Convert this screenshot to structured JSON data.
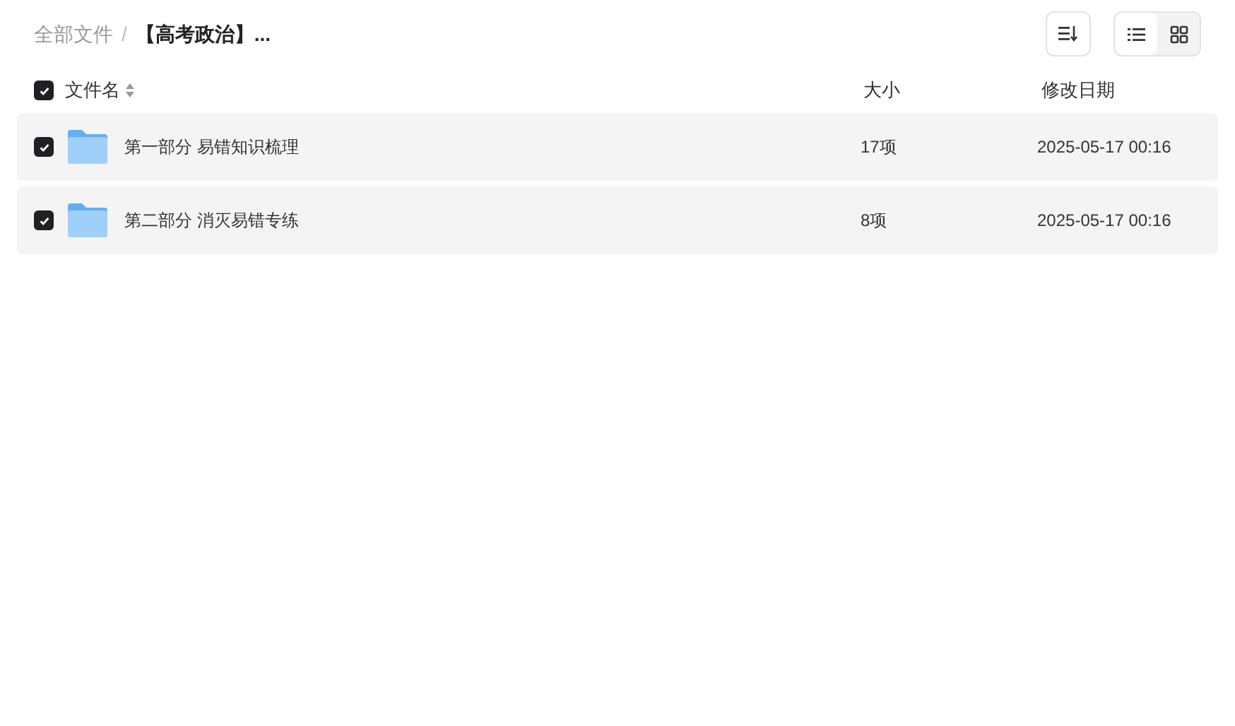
{
  "breadcrumb": [
    {
      "label": "全部文件",
      "current": false
    },
    {
      "label": "【高考政治】...",
      "current": true
    }
  ],
  "breadcrumb_separator": "/",
  "view_modes": [
    {
      "kind": "list",
      "selected": true
    },
    {
      "kind": "grid",
      "selected": false
    }
  ],
  "header": {
    "checked": true,
    "columns": [
      "文件名",
      "大小",
      "修改日期"
    ]
  },
  "rows": [
    {
      "name": "第一部分 易错知识梳理",
      "size": "17项",
      "date": "2025-05-17 00:16",
      "checked": true
    },
    {
      "name": "第二部分 消灭易错专练",
      "size": "8项",
      "date": "2025-05-17 00:16",
      "checked": true
    }
  ]
}
